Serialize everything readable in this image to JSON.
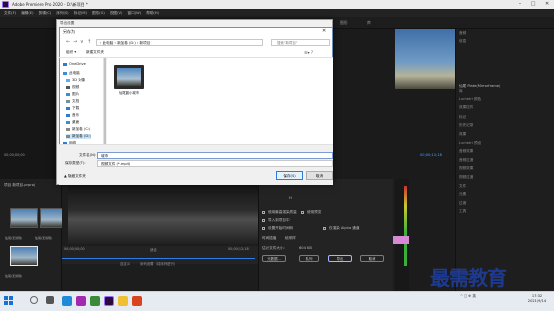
{
  "premiere": {
    "title": "Adobe Premiere Pro 2020 - D:\\新项目 *",
    "menu": [
      "文件(F)",
      "编辑(E)",
      "剪辑(C)",
      "序列(S)",
      "标记(M)",
      "图形(G)",
      "视图(V)",
      "窗口(W)",
      "帮助(H)"
    ],
    "workspaces": [
      "学习",
      "组件",
      "编辑",
      "颜色",
      "效果",
      "音频",
      "图形",
      "库"
    ],
    "project_label": "项目 新项目.prproj",
    "thumbs": [
      "仙尾(无剪辑)",
      "仙尾(无剪辑)",
      "仙尾(无剪辑)"
    ],
    "timecode_left": "00;00;00;00",
    "timecode_right": "00;00;12;18",
    "timecode_blue": "00;00;12;18",
    "tl_labels": [
      "00;00;00;00",
      "适合",
      "00;00;12;18",
      "自定义",
      "序列设置（将序列进行）"
    ],
    "right_panel": [
      "音频",
      "信息",
      "库",
      "Lumetri 颜色",
      "效果控件",
      "标记",
      "历史记录",
      "效果",
      "Lumetri 预设",
      "音频效果",
      "音频过渡",
      "视频效果",
      "视频过渡",
      "文件",
      "元素",
      "过渡",
      "工具"
    ],
    "right_header": "仙尾 Plate(Mirrorframe)",
    "export_panel": {
      "lines": [
        "H",
        "使用最高渲染质量",
        "使用预览",
        "导入到项目中",
        "设置开始时间码",
        "仅渲染 Alpha 通道",
        "时间插值",
        "帧采样",
        "估计文件大小:",
        "604 KB"
      ],
      "btns": [
        "元数据...",
        "队列",
        "导出",
        "取消"
      ]
    }
  },
  "dialog": {
    "outer_title": "导出设置",
    "title": "另存为",
    "close": "✕",
    "nav": [
      "←",
      "→",
      "∨",
      "↑"
    ],
    "address": "› 此电脑 › 新加卷 (D:) › 新项目",
    "search_placeholder": "搜索“新项目”",
    "toolbar": [
      "组织 ▾",
      "新建文件夹"
    ],
    "view_icons": "☰▾  ?",
    "sidebar": [
      "OneDrive",
      "此电脑",
      "3D 对象",
      "视频",
      "图片",
      "文档",
      "下载",
      "音乐",
      "桌面",
      "新加卷 (C:)",
      "新加卷 (D:)",
      "网络"
    ],
    "file_name": "仙尾晨小城市",
    "filename_label": "文件名(N):",
    "filename_value": "城市",
    "filetype_label": "保存类型(T):",
    "filetype_value": "视频文件 (*.mp4)",
    "hide_folders": "▲ 隐藏文件夹",
    "save_btn": "保存(S)",
    "cancel_btn": "取消"
  },
  "watermark": "最需教育",
  "taskbar": {
    "tray": "^  ◻  ⊕  英",
    "time": "17:32",
    "date": "2021/9/14"
  }
}
